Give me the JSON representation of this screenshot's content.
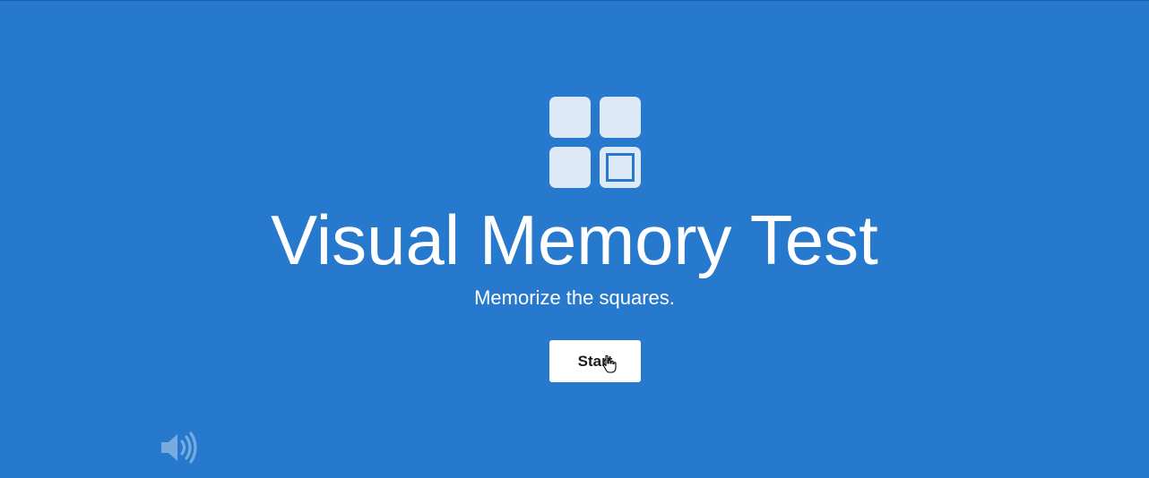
{
  "app": {
    "title": "Visual Memory Test",
    "subtitle": "Memorize the squares.",
    "start_label": "Start"
  },
  "icons": {
    "logo": "grid-squares-icon",
    "sound": "speaker-volume-icon",
    "cursor": "hand-pointer-cursor-icon"
  },
  "colors": {
    "background": "#2679cc",
    "tile": "#dde9f6",
    "button_bg": "#ffffff",
    "button_text": "#1a1a1a"
  }
}
